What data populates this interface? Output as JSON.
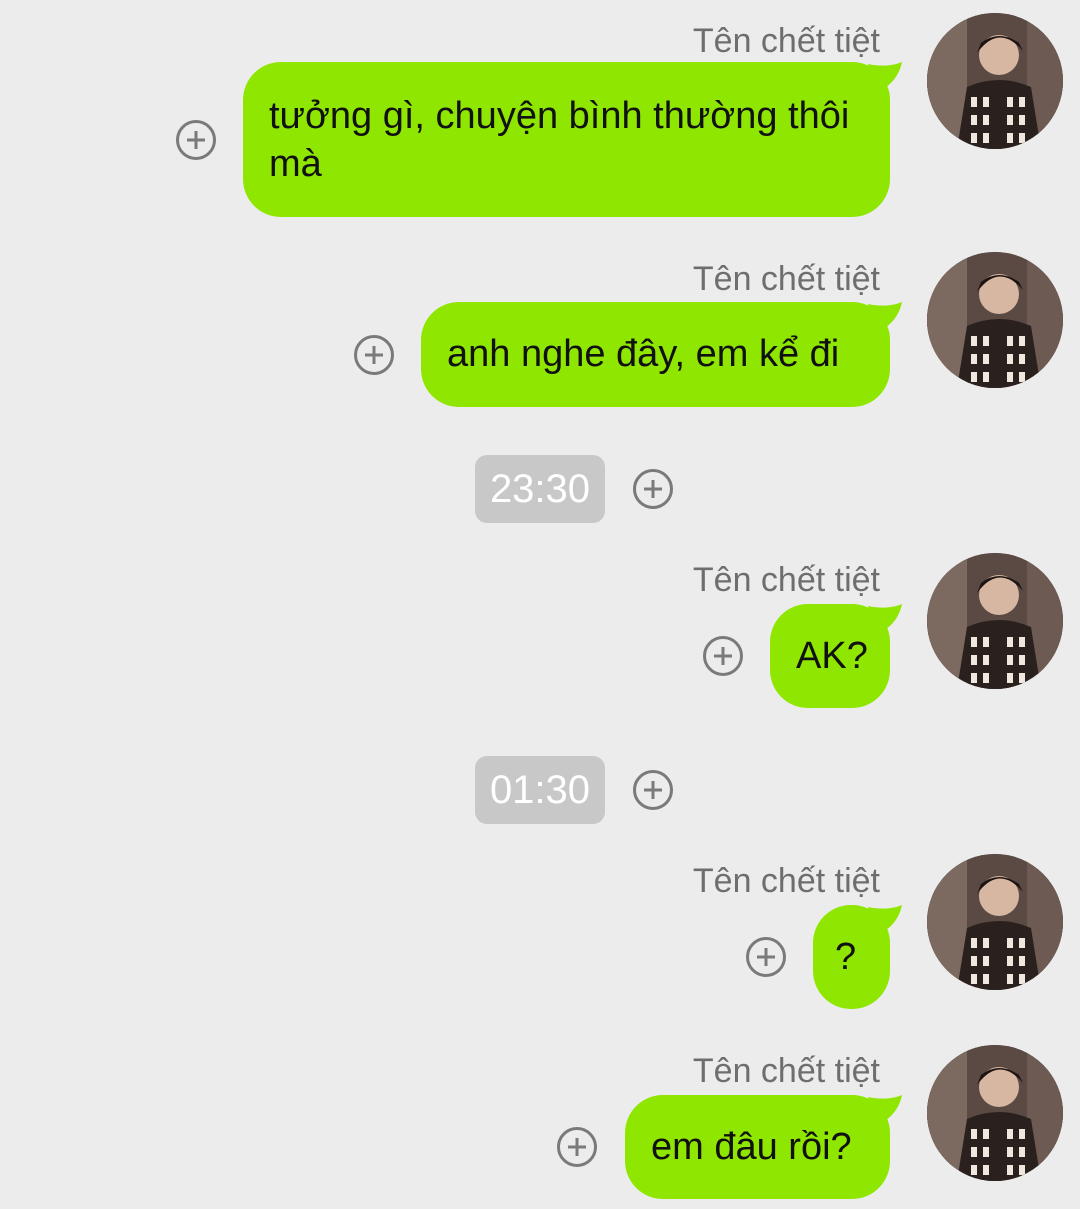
{
  "conversation": {
    "messages": [
      {
        "sender": "Tên chết tiệt",
        "text": "tưởng gì, chuyện bình thường thôi mà"
      },
      {
        "sender": "Tên chết tiệt",
        "text": "anh nghe đây, em kể đi"
      },
      {
        "sender": "Tên chết tiệt",
        "text": "AK?"
      },
      {
        "sender": "Tên chết tiệt",
        "text": "?"
      },
      {
        "sender": "Tên chết tiệt",
        "text": "em đâu rồi?"
      }
    ],
    "timestamps": [
      "23:30",
      "01:30"
    ]
  },
  "colors": {
    "bubble": "#8fe600",
    "background": "#ececec",
    "timestamp_chip": "#c8c8c8",
    "icon": "#7a7a7a"
  },
  "icons": {
    "add": "plus-circle-icon",
    "avatar": "profile-photo"
  }
}
